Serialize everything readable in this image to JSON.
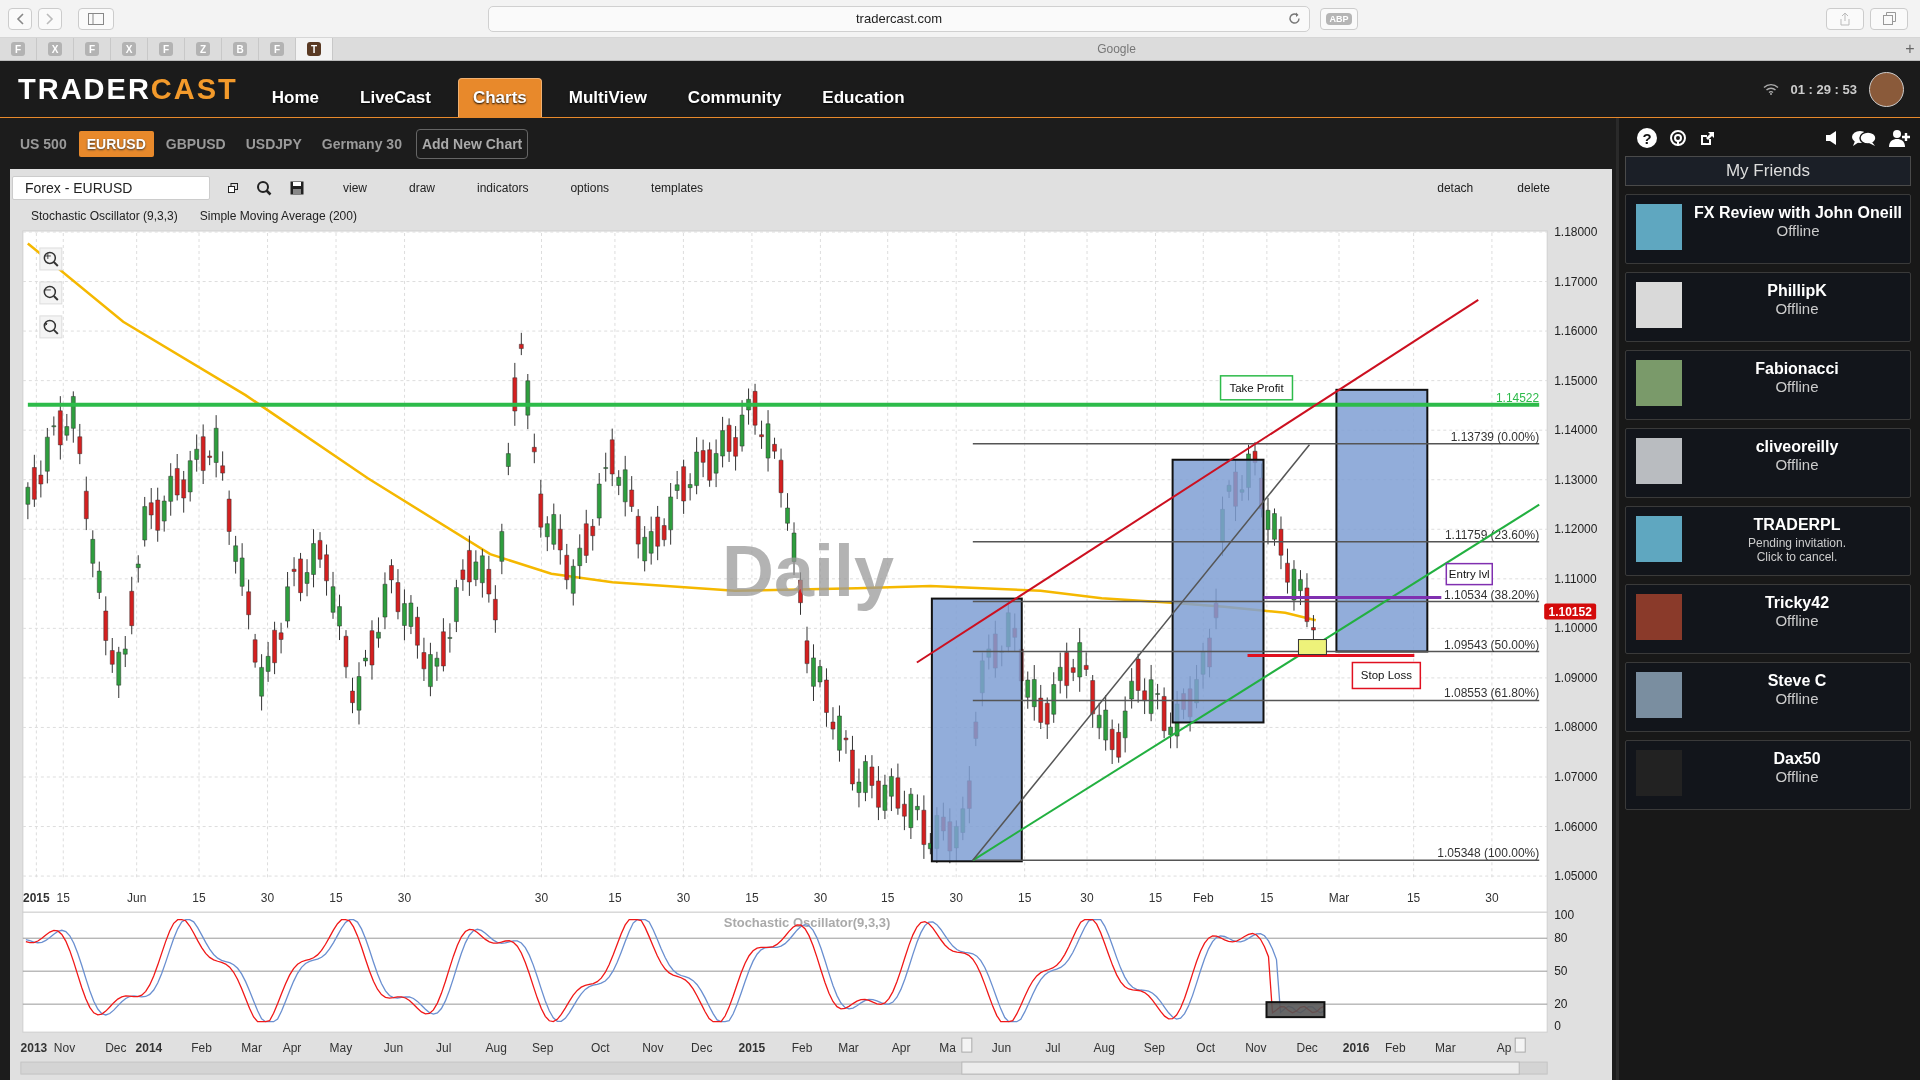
{
  "browser": {
    "url": "tradercast.com",
    "adblock": "ABP",
    "favicons": [
      {
        "letter": "F",
        "selected": false
      },
      {
        "letter": "X",
        "selected": false
      },
      {
        "letter": "F",
        "selected": false
      },
      {
        "letter": "X",
        "selected": false
      },
      {
        "letter": "F",
        "selected": false
      },
      {
        "letter": "Z",
        "selected": false
      },
      {
        "letter": "B",
        "selected": false
      },
      {
        "letter": "F",
        "selected": false
      },
      {
        "letter": "T",
        "selected": true
      }
    ],
    "tab_title": "Google",
    "new_tab": "+"
  },
  "header": {
    "logo_main": "TRADER",
    "logo_accent": "CAST",
    "clock": "01 : 29 : 53",
    "nav": [
      {
        "label": "Home",
        "selected": false
      },
      {
        "label": "LiveCast",
        "selected": false
      },
      {
        "label": "Charts",
        "selected": true
      },
      {
        "label": "MultiView",
        "selected": false
      },
      {
        "label": "Community",
        "selected": false
      },
      {
        "label": "Education",
        "selected": false
      }
    ]
  },
  "instruments": {
    "items": [
      {
        "label": "US 500",
        "selected": false
      },
      {
        "label": "EURUSD",
        "selected": true
      },
      {
        "label": "GBPUSD",
        "selected": false
      },
      {
        "label": "USDJPY",
        "selected": false
      },
      {
        "label": "Germany 30",
        "selected": false
      }
    ],
    "add_button": "Add New Chart"
  },
  "chart": {
    "symbol": "Forex - EURUSD",
    "menu": [
      "view",
      "draw",
      "indicators",
      "options",
      "templates"
    ],
    "actions": [
      "detach",
      "delete"
    ],
    "indicators": [
      "Stochastic Oscillator (9,3,3)",
      "Simple Moving Average (200)"
    ],
    "watermark": "Daily",
    "price_ticks": [
      "1.18000",
      "1.17000",
      "1.16000",
      "1.15000",
      "1.14000",
      "1.13000",
      "1.12000",
      "1.11000",
      "1.10000",
      "1.09000",
      "1.08000",
      "1.07000",
      "1.06000",
      "1.05000"
    ],
    "current_price": "1.10152",
    "take_profit_level": "1.14522",
    "take_profit": "Take Profit",
    "stop_loss": "Stop Loss",
    "entry": "Entry lvl",
    "fib_levels": [
      "1.13739 (0.00%)",
      "1.11759 (23.60%)",
      "1.10534 (38.20%)",
      "1.09543 (50.00%)",
      "1.08553 (61.80%)",
      "1.05348 (100.00%)"
    ],
    "x_labels": [
      {
        "text": "2015",
        "kind": "year"
      },
      {
        "text": "15",
        "kind": "day"
      },
      {
        "text": "Jun",
        "kind": "month"
      },
      {
        "text": "15",
        "kind": "day"
      },
      {
        "text": "30",
        "kind": "day"
      },
      {
        "text": "15",
        "kind": "day"
      },
      {
        "text": "30",
        "kind": "day"
      },
      {
        "text": "30",
        "kind": "day"
      },
      {
        "text": "15",
        "kind": "day"
      },
      {
        "text": "30",
        "kind": "day"
      },
      {
        "text": "15",
        "kind": "day"
      },
      {
        "text": "30",
        "kind": "day"
      },
      {
        "text": "15",
        "kind": "day"
      },
      {
        "text": "30",
        "kind": "day"
      },
      {
        "text": "15",
        "kind": "day"
      },
      {
        "text": "30",
        "kind": "day"
      },
      {
        "text": "15",
        "kind": "day"
      },
      {
        "text": "Feb",
        "kind": "month"
      },
      {
        "text": "15",
        "kind": "day"
      },
      {
        "text": "Mar",
        "kind": "month"
      },
      {
        "text": "15",
        "kind": "day"
      },
      {
        "text": "30",
        "kind": "day"
      }
    ]
  },
  "oscillator": {
    "title": "Stochastic Oscillator(9,3,3)",
    "ticks": [
      "100",
      "80",
      "50",
      "20",
      "0"
    ],
    "x_labels": [
      {
        "text": "2013",
        "kind": "year"
      },
      {
        "text": "Nov",
        "kind": "month"
      },
      {
        "text": "Dec",
        "kind": "month"
      },
      {
        "text": "2014",
        "kind": "year"
      },
      {
        "text": "Feb",
        "kind": "month"
      },
      {
        "text": "Mar",
        "kind": "month"
      },
      {
        "text": "Apr",
        "kind": "month"
      },
      {
        "text": "May",
        "kind": "month"
      },
      {
        "text": "Jun",
        "kind": "month"
      },
      {
        "text": "Jul",
        "kind": "month"
      },
      {
        "text": "Aug",
        "kind": "month"
      },
      {
        "text": "Sep",
        "kind": "month"
      },
      {
        "text": "Oct",
        "kind": "month"
      },
      {
        "text": "Nov",
        "kind": "month"
      },
      {
        "text": "Dec",
        "kind": "month"
      },
      {
        "text": "2015",
        "kind": "year"
      },
      {
        "text": "Feb",
        "kind": "month"
      },
      {
        "text": "Mar",
        "kind": "month"
      },
      {
        "text": "Apr",
        "kind": "month"
      },
      {
        "text": "Ma",
        "kind": "month"
      },
      {
        "text": "Jun",
        "kind": "month"
      },
      {
        "text": "Jul",
        "kind": "month"
      },
      {
        "text": "Aug",
        "kind": "month"
      },
      {
        "text": "Sep",
        "kind": "month"
      },
      {
        "text": "Oct",
        "kind": "month"
      },
      {
        "text": "Nov",
        "kind": "month"
      },
      {
        "text": "Dec",
        "kind": "month"
      },
      {
        "text": "2016",
        "kind": "year"
      },
      {
        "text": "Feb",
        "kind": "month"
      },
      {
        "text": "Mar",
        "kind": "month"
      },
      {
        "text": "Ap",
        "kind": "month"
      }
    ]
  },
  "sidebar": {
    "help": "?",
    "title": "My Friends",
    "friends": [
      {
        "name": "FX Review with John Oneill",
        "status": "Offline",
        "kind": "offline"
      },
      {
        "name": "PhillipK",
        "status": "Offline",
        "kind": "offline"
      },
      {
        "name": "Fabionacci",
        "status": "Offline",
        "kind": "offline"
      },
      {
        "name": "cliveoreilly",
        "status": "Offline",
        "kind": "offline"
      },
      {
        "name": "TRADERPL",
        "status": "Pending invitation. Click to cancel.",
        "kind": "pending"
      },
      {
        "name": "Tricky42",
        "status": "Offline",
        "kind": "offline"
      },
      {
        "name": "Steve C",
        "status": "Offline",
        "kind": "offline"
      },
      {
        "name": "Dax50",
        "status": "Offline",
        "kind": "offline"
      }
    ]
  }
}
